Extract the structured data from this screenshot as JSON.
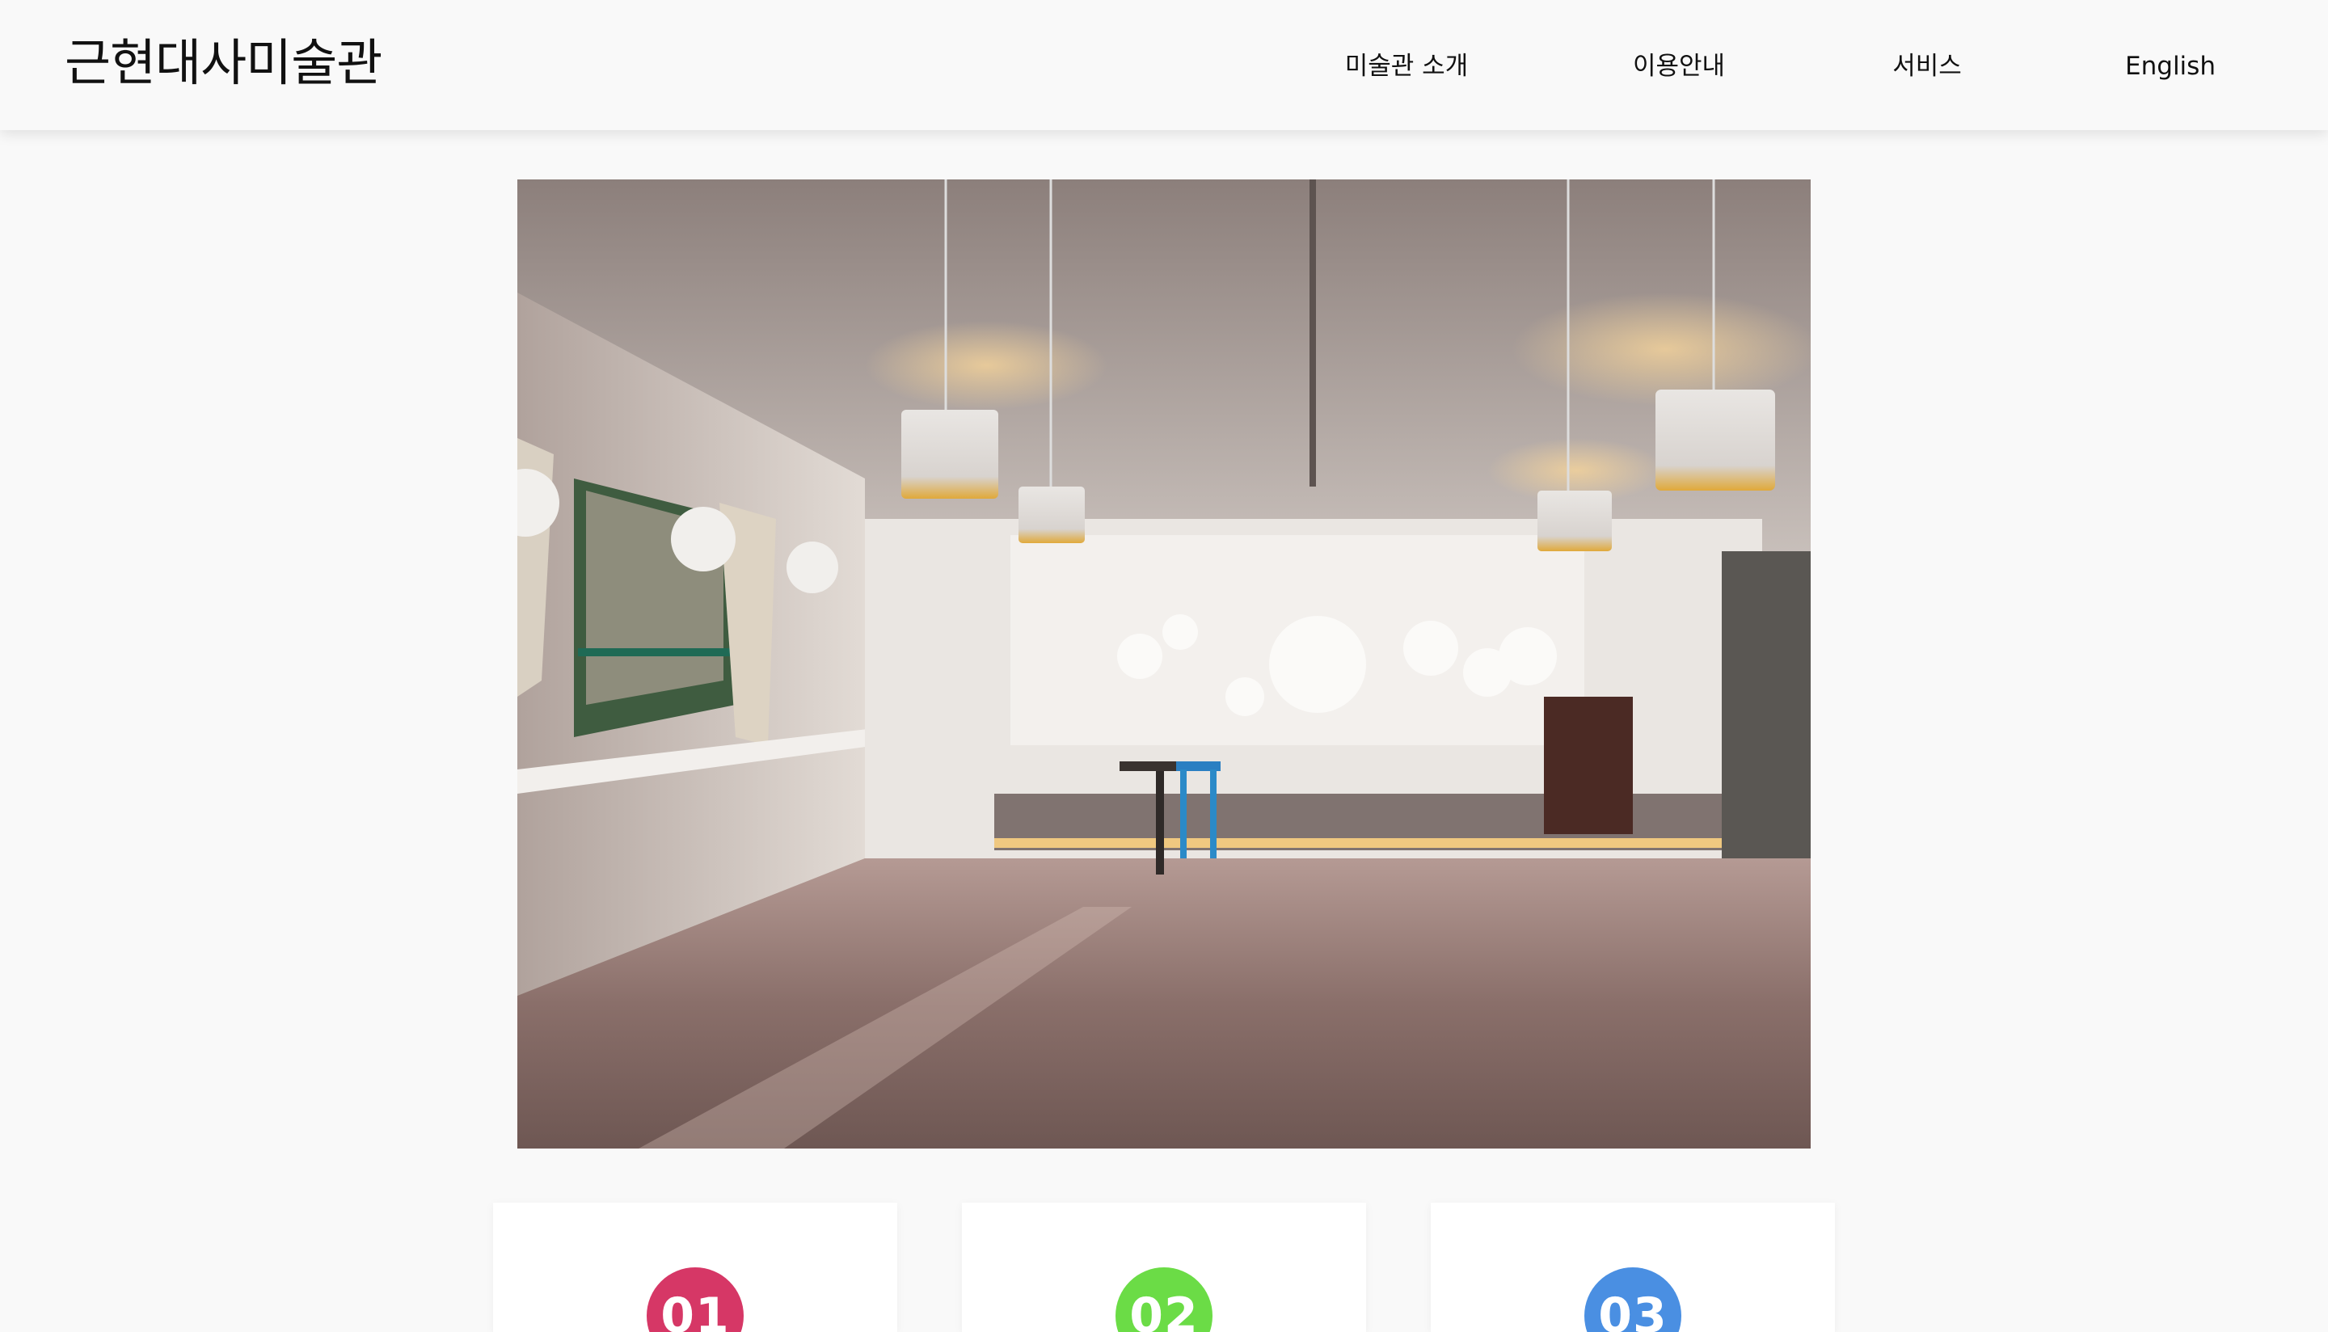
{
  "header": {
    "logo": "근현대사미술관",
    "nav": [
      {
        "label": "미술관 소개"
      },
      {
        "label": "이용안내"
      },
      {
        "label": "서비스"
      },
      {
        "label": "English"
      }
    ]
  },
  "cards": [
    {
      "number": "01",
      "color": "#d63766"
    },
    {
      "number": "02",
      "color": "#6bdc46"
    },
    {
      "number": "03",
      "color": "#4a8fe2"
    }
  ]
}
